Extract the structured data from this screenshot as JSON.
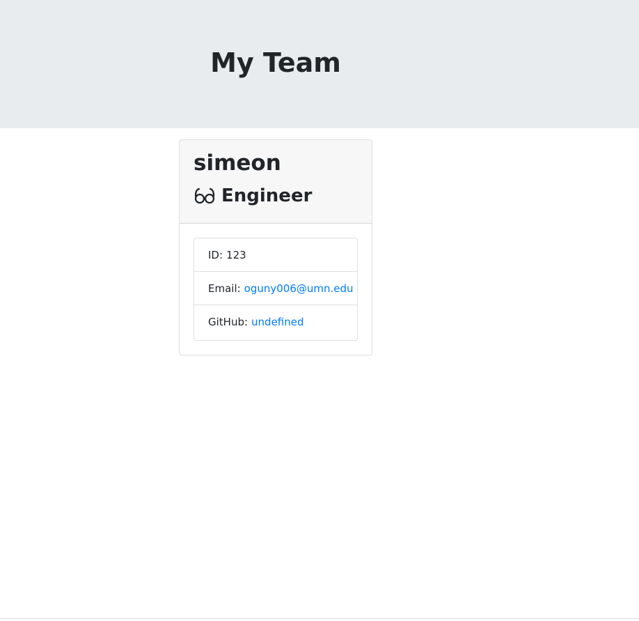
{
  "header": {
    "title": "My Team"
  },
  "employee": {
    "name": "simeon",
    "role": "Engineer",
    "role_icon": "glasses-icon",
    "details": {
      "id_label": "ID:",
      "id_value": "123",
      "email_label": "Email:",
      "email_value": "oguny006@umn.edu",
      "github_label": "GitHub:",
      "github_value": "undefined"
    }
  },
  "colors": {
    "header_background": "#e9ecef",
    "card_header_background": "#f7f7f7",
    "link": "#007bff",
    "text": "#212529"
  }
}
